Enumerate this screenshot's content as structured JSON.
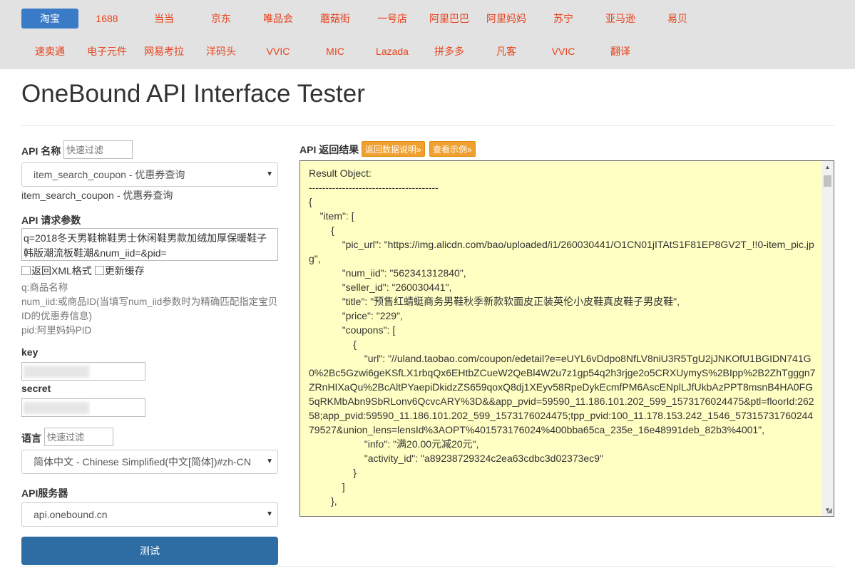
{
  "nav": {
    "row1": [
      "淘宝",
      "1688",
      "当当",
      "京东",
      "唯品会",
      "蘑菇街",
      "一号店",
      "阿里巴巴",
      "阿里妈妈",
      "苏宁",
      "亚马逊",
      "易贝"
    ],
    "row2": [
      "速卖通",
      "电子元件",
      "网易考拉",
      "洋码头",
      "VVIC",
      "MIC",
      "Lazada",
      "拼多多",
      "凡客",
      "VVIC",
      "翻译"
    ],
    "active": "淘宝"
  },
  "page_title": "OneBound API Interface Tester",
  "api": {
    "label": "API 名称",
    "filter_placeholder": "快速过滤",
    "selected": "item_search_coupon - 优惠券查询",
    "caption": "item_search_coupon - 优惠券查询"
  },
  "params": {
    "label": "API 请求参数",
    "value": "q=2018冬天男鞋棉鞋男士休闲鞋男款加绒加厚保暖鞋子韩版潮流板鞋潮&num_iid=&pid=",
    "xml_label": "返回XML格式",
    "cache_label": "更新缓存",
    "desc": [
      "q:商品名称",
      "num_iid:或商品ID(当填写num_iid参数时为精确匹配指定宝贝ID的优惠券信息)",
      "pid:阿里妈妈PID"
    ]
  },
  "key": {
    "label": "key"
  },
  "secret": {
    "label": "secret"
  },
  "lang": {
    "label": "语言",
    "filter_placeholder": "快速过滤",
    "selected": "简体中文 - Chinese Simplified(中文[简体])#zh-CN"
  },
  "server": {
    "label": "API服务器",
    "selected": "api.onebound.cn"
  },
  "test_button": "测试",
  "result": {
    "label": "API 返回结果",
    "doc_button": "返回数据说明»",
    "example_button": "查看示例»",
    "text": "Result Object:\n---------------------------------------\n{\n\t\"item\": [\n\t\t{\n\t\t\t\"pic_url\": \"https://img.alicdn.com/bao/uploaded/i1/260030441/O1CN01jITAtS1F81EP8GV2T_!!0-item_pic.jpg\",\n\t\t\t\"num_iid\": \"562341312840\",\n\t\t\t\"seller_id\": \"260030441\",\n\t\t\t\"title\": \"预售红蜻蜓商务男鞋秋季新款软面皮正装英伦小皮鞋真皮鞋子男皮鞋\",\n\t\t\t\"price\": \"229\",\n\t\t\t\"coupons\": [\n\t\t\t\t{\n\t\t\t\t\t\"url\": \"//uland.taobao.com/coupon/edetail?e=eUYL6vDdpo8NfLV8niU3R5TgU2jJNKOfU1BGIDN741G0%2Bc5Gzwi6geKSfLX1rbqQx6EHtbZCueW2QeBl4W2u7z1gp54q2h3rjge2o5CRXUymyS%2BIpp%2B2ZhTgggn7ZRnHIXaQu%2BcAltPYaepiDkidzZS659qoxQ8dj1XEyv58RpeDykEcmfPM6AscENplLJfUkbAzPPT8msnB4HA0FG5qRKMbAbn9SbRLonv6QcvcARY%3D&&app_pvid=59590_11.186.101.202_599_1573176024475&ptl=floorId:26258;app_pvid:59590_11.186.101.202_599_1573176024475;tpp_pvid:100_11.178.153.242_1546_5731573176024479527&union_lens=lensId%3AOPT%401573176024%400bba65ca_235e_16e48991deb_82b3%4001\",\n\t\t\t\t\t\"info\": \"满20.00元减20元\",\n\t\t\t\t\t\"activity_id\": \"a89238729324c2ea63cdbc3d02373ec9\"\n\t\t\t\t}\n\t\t\t]\n\t\t},"
  }
}
